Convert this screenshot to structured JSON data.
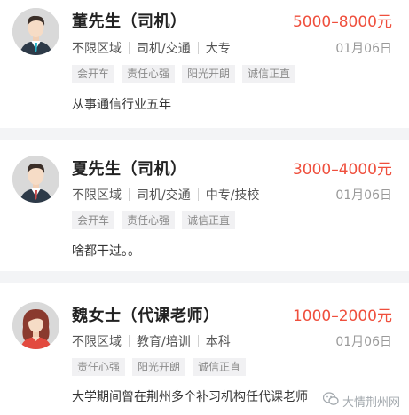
{
  "listings": [
    {
      "name": "董先生（司机）",
      "salary": "5000–8000元",
      "meta": [
        "不限区域",
        "司机/交通",
        "大专"
      ],
      "date": "01月06日",
      "tags": [
        "会开车",
        "责任心强",
        "阳光开朗",
        "诚信正直"
      ],
      "desc": "从事通信行业五年",
      "avatar_icon": "male-avatar-icon"
    },
    {
      "name": "夏先生（司机）",
      "salary": "3000–4000元",
      "meta": [
        "不限区域",
        "司机/交通",
        "中专/技校"
      ],
      "date": "01月06日",
      "tags": [
        "会开车",
        "责任心强",
        "诚信正直"
      ],
      "desc": "啥都干过。。",
      "avatar_icon": "male-avatar-icon"
    },
    {
      "name": "魏女士（代课老师）",
      "salary": "1000–2000元",
      "meta": [
        "不限区域",
        "教育/培训",
        "本科"
      ],
      "date": "01月06日",
      "tags": [
        "责任心强",
        "阳光开朗",
        "诚信正直"
      ],
      "desc": "大学期间曾在荆州多个补习机构任代课老师",
      "avatar_icon": "female-avatar-icon"
    }
  ],
  "watermark": {
    "text": "大情荆州网",
    "icon": "wechat-icon"
  },
  "colors": {
    "salary": "#ef4f3d",
    "separator_band": "#f3f4f6",
    "tag_bg": "#f1f1f3"
  }
}
